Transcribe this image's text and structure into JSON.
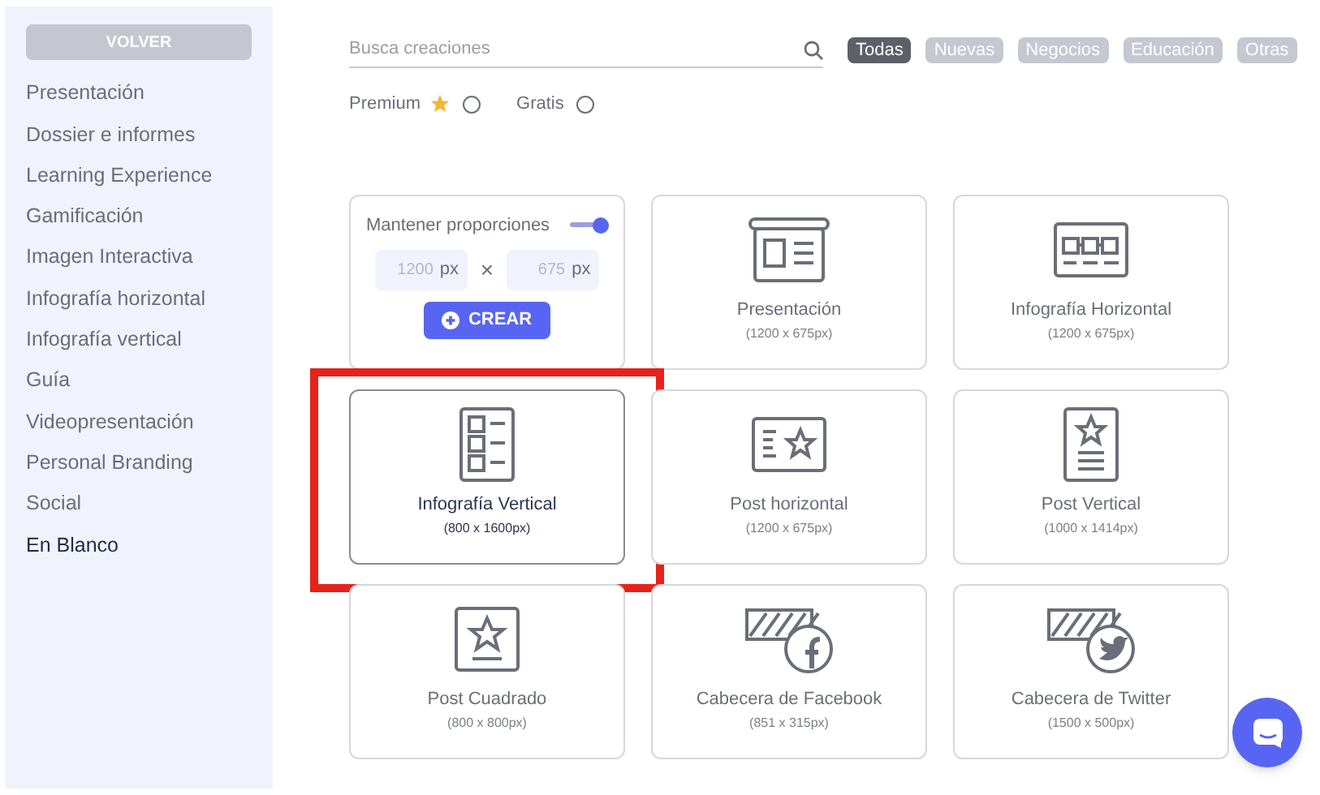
{
  "sidebar": {
    "back_button": "VOLVER",
    "items": [
      {
        "label": "Presentación",
        "selected": false
      },
      {
        "label": "Dossier e informes",
        "selected": false
      },
      {
        "label": "Learning Experience",
        "selected": false
      },
      {
        "label": "Gamificación",
        "selected": false
      },
      {
        "label": "Imagen Interactiva",
        "selected": false
      },
      {
        "label": "Infografía horizontal",
        "selected": false
      },
      {
        "label": "Infografía vertical",
        "selected": false
      },
      {
        "label": "Guía",
        "selected": false
      },
      {
        "label": "Videopresentación",
        "selected": false
      },
      {
        "label": "Personal Branding",
        "selected": false
      },
      {
        "label": "Social",
        "selected": false
      },
      {
        "label": "En Blanco",
        "selected": true
      }
    ]
  },
  "search": {
    "placeholder": "Busca creaciones"
  },
  "filters": [
    {
      "label": "Todas",
      "selected": true
    },
    {
      "label": "Nuevas",
      "selected": false
    },
    {
      "label": "Negocios",
      "selected": false
    },
    {
      "label": "Educación",
      "selected": false
    },
    {
      "label": "Otras",
      "selected": false
    }
  ],
  "pricing": [
    {
      "label": "Premium",
      "star": true,
      "checked": false
    },
    {
      "label": "Gratis",
      "star": false,
      "checked": false
    }
  ],
  "cards": [
    {
      "kind": "custom",
      "toggle_label": "Mantener proporciones",
      "toggle_on": true,
      "width_placeholder": "1200",
      "height_placeholder": "675",
      "width_unit": "px",
      "height_unit": "px",
      "times": "×",
      "button": "CREAR"
    },
    {
      "kind": "template",
      "title": "Presentación",
      "size": "(1200 x 675px)",
      "selected": false
    },
    {
      "kind": "template",
      "title": "Infografía Horizontal",
      "size": "(1200 x 675px)",
      "selected": false
    },
    {
      "kind": "template",
      "title": "Infografía Vertical",
      "size": "(800 x 1600px)",
      "selected": true
    },
    {
      "kind": "template",
      "title": "Post horizontal",
      "size": "(1200 x 675px)",
      "selected": false
    },
    {
      "kind": "template",
      "title": "Post Vertical",
      "size": "(1000 x 1414px)",
      "selected": false
    },
    {
      "kind": "template",
      "title": "Post Cuadrado",
      "size": "(800 x 800px)",
      "selected": false
    },
    {
      "kind": "template",
      "title": "Cabecera de Facebook",
      "size": "(851 x 315px)",
      "selected": false
    },
    {
      "kind": "template",
      "title": "Cabecera de Twitter",
      "size": "(1500 x 500px)",
      "selected": false
    }
  ]
}
